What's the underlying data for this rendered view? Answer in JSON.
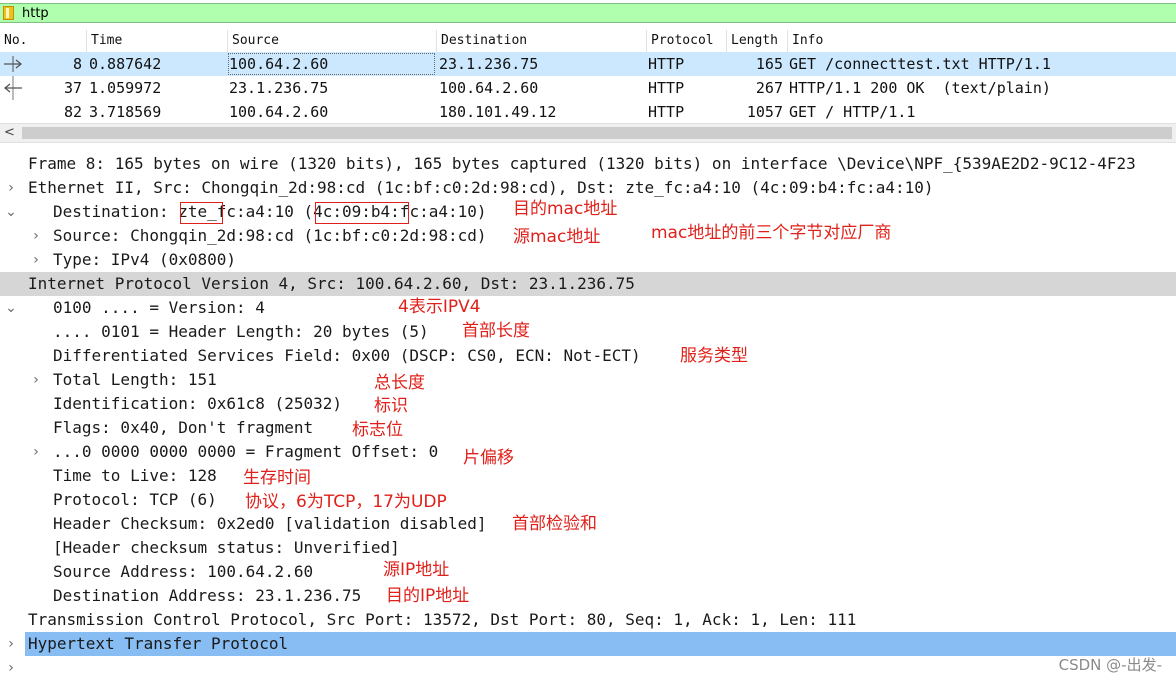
{
  "filter": {
    "value": "http",
    "bookmark_icon": "bookmark-icon",
    "bg_color": "#afffaf"
  },
  "packet_list": {
    "columns": [
      "No.",
      "Time",
      "Source",
      "Destination",
      "Protocol",
      "Length",
      "Info"
    ],
    "rows": [
      {
        "no": "8",
        "time": "0.887642",
        "source": "100.64.2.60",
        "destination": "23.1.236.75",
        "protocol": "HTTP",
        "length": "165",
        "info": "GET /connecttest.txt HTTP/1.1"
      },
      {
        "no": "37",
        "time": "1.059972",
        "source": "23.1.236.75",
        "destination": "100.64.2.60",
        "protocol": "HTTP",
        "length": "267",
        "info": "HTTP/1.1 200 OK  (text/plain)"
      },
      {
        "no": "82",
        "time": "3.718569",
        "source": "100.64.2.60",
        "destination": "180.101.49.12",
        "protocol": "HTTP",
        "length": "1057",
        "info": "GET / HTTP/1.1"
      }
    ],
    "scroll_left": "<"
  },
  "tree": {
    "frame": "Frame 8: 165 bytes on wire (1320 bits), 165 bytes captured (1320 bits) on interface \\Device\\NPF_{539AE2D2-9C12-4F23",
    "ethernet": "Ethernet II, Src: Chongqin_2d:98:cd (1c:bf:c0:2d:98:cd), Dst: zte_fc:a4:10 (4c:09:b4:fc:a4:10)",
    "eth_dst_prefix": "Destination: ",
    "eth_dst_name": "zte_",
    "eth_dst_mid": "fc:a4:10 ",
    "eth_dst_mac": "(4c:09:b4",
    "eth_dst_suffix": ":fc:a4:10)",
    "eth_src": "Source: Chongqin_2d:98:cd (1c:bf:c0:2d:98:cd)",
    "eth_type": "Type: IPv4 (0x0800)",
    "ip": "Internet Protocol Version 4, Src: 100.64.2.60, Dst: 23.1.236.75",
    "ip_version": "0100 .... = Version: 4",
    "ip_hlen": ".... 0101 = Header Length: 20 bytes (5)",
    "ip_dsf": "Differentiated Services Field: 0x00 (DSCP: CS0, ECN: Not-ECT)",
    "ip_total": "Total Length: 151",
    "ip_id": "Identification: 0x61c8 (25032)",
    "ip_flags": "Flags: 0x40, Don't fragment",
    "ip_frag": "...0 0000 0000 0000 = Fragment Offset: 0",
    "ip_ttl": "Time to Live: 128",
    "ip_proto": "Protocol: TCP (6)",
    "ip_checksum": "Header Checksum: 0x2ed0 [validation disabled]",
    "ip_checksum_status": "[Header checksum status: Unverified]",
    "ip_src": "Source Address: 100.64.2.60",
    "ip_dst": "Destination Address: 23.1.236.75",
    "tcp": "Transmission Control Protocol, Src Port: 13572, Dst Port: 80, Seq: 1, Ack: 1, Len: 111",
    "http": "Hypertext Transfer Protocol"
  },
  "annotations": {
    "dst_mac": "目的mac地址",
    "src_mac": "源mac地址",
    "oui": "mac地址的前三个字节对应厂商",
    "version": "4表示IPV4",
    "hlen": "首部长度",
    "dsf": "服务类型",
    "total": "总长度",
    "id": "标识",
    "flags": "标志位",
    "frag": "片偏移",
    "ttl": "生存时间",
    "proto": "协议，6为TCP，17为UDP",
    "checksum": "首部检验和",
    "src_ip": "源IP地址",
    "dst_ip": "目的IP地址",
    "color": "#e0201a"
  },
  "watermark": "CSDN @-出发-"
}
